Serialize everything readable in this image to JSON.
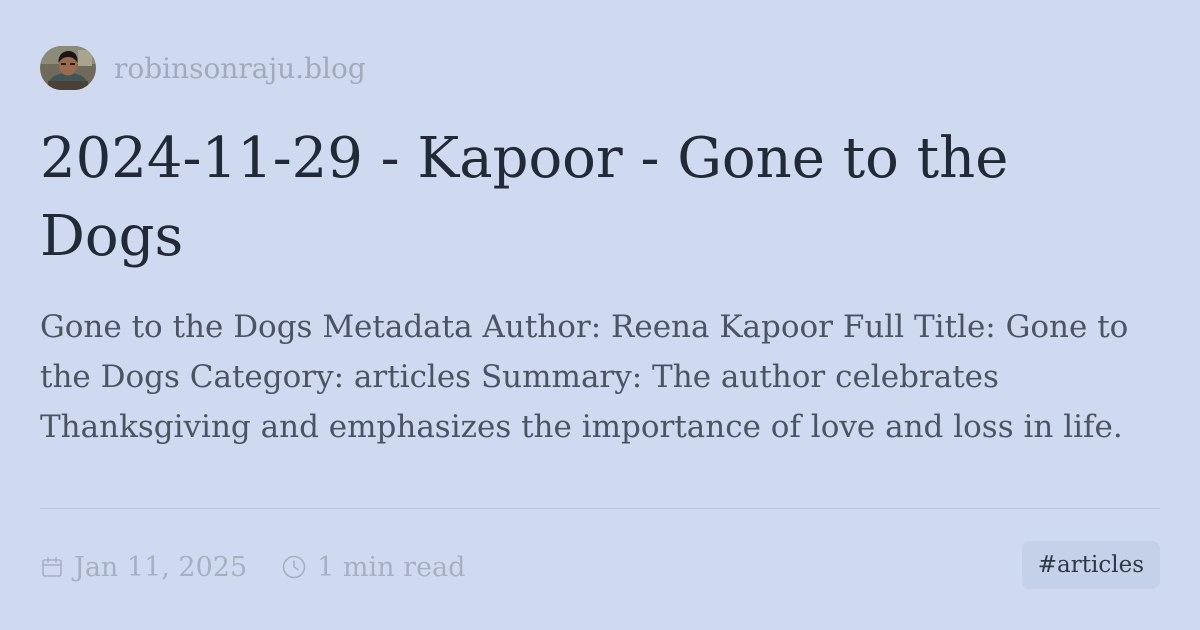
{
  "site": {
    "name": "robinsonraju.blog"
  },
  "post": {
    "title": "2024-11-29 - Kapoor - Gone to the Dogs",
    "summary": "Gone to the Dogs Metadata Author: Reena Kapoor Full Title: Gone to the Dogs Category: articles Summary: The author celebrates Thanksgiving and emphasizes the importance of love and loss in life."
  },
  "meta": {
    "date": "Jan 11, 2025",
    "read_time": "1 min read",
    "tag": "#articles"
  },
  "colors": {
    "background": "#cfdaf0",
    "title": "#212a36",
    "summary": "#4a5463",
    "muted": "#a2abbb",
    "tag_background": "#c4d1e8"
  },
  "icons": {
    "date": "calendar-icon",
    "read_time": "clock-icon"
  }
}
